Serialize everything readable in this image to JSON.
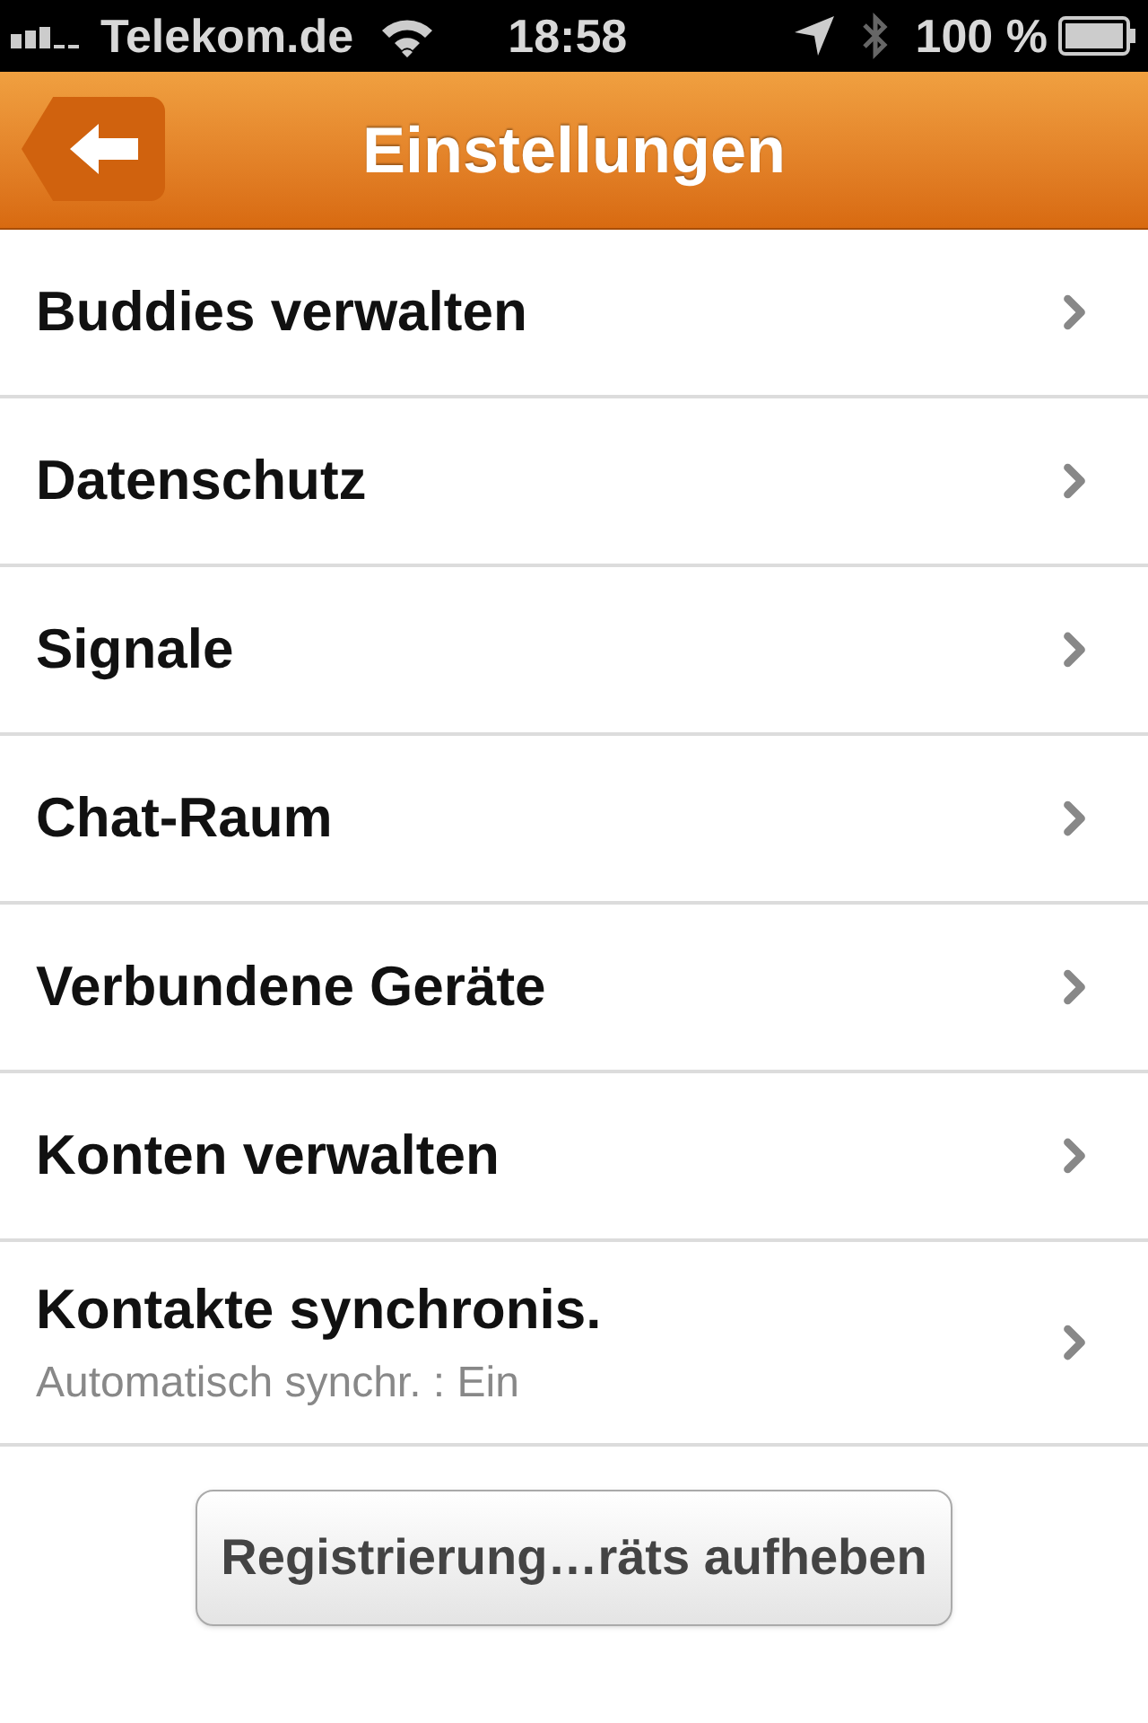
{
  "status_bar": {
    "carrier": "Telekom.de",
    "time": "18:58",
    "battery": "100 %"
  },
  "nav_bar": {
    "title": "Einstellungen"
  },
  "settings": [
    {
      "label": "Buddies verwalten"
    },
    {
      "label": "Datenschutz"
    },
    {
      "label": "Signale"
    },
    {
      "label": "Chat-Raum"
    },
    {
      "label": "Verbundene Geräte"
    },
    {
      "label": "Konten verwalten"
    },
    {
      "label": "Kontakte synchronis.",
      "detail": "Automatisch synchr. : Ein"
    }
  ],
  "button": "Registrierung…räts aufheben"
}
